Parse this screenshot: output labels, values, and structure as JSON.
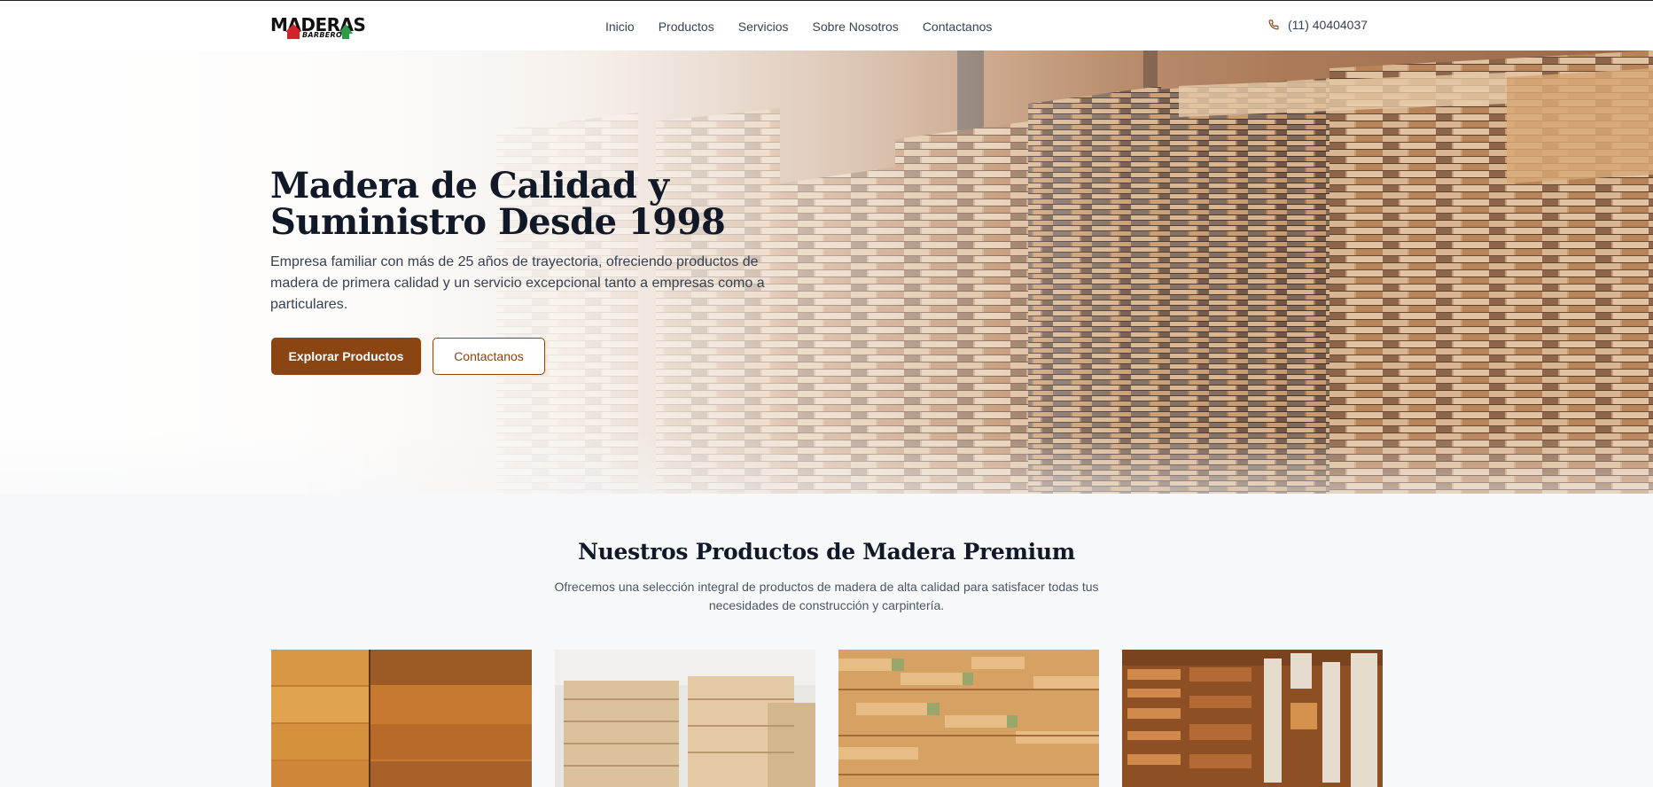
{
  "header": {
    "logo_text": "MADERAS",
    "logo_sub": "BARBERO",
    "nav": [
      "Inicio",
      "Productos",
      "Servicios",
      "Sobre Nosotros",
      "Contactanos"
    ],
    "phone": "(11) 40404037",
    "phone_icon": "phone-icon"
  },
  "hero": {
    "title_line1": "Madera de Calidad y",
    "title_line2": "Suministro Desde 1998",
    "description": "Empresa familiar con más de 25 años de trayectoria, ofreciendo productos de madera de primera calidad y un servicio excepcional tanto a empresas como a particulares.",
    "primary_button": "Explorar Productos",
    "secondary_button": "Contactanos"
  },
  "products": {
    "title": "Nuestros Productos de Madera Premium",
    "description": "Ofrecemos una selección integral de productos de madera de alta calidad para satisfacer todas tus necesidades de construcción y carpintería."
  },
  "colors": {
    "accent": "#8a4513",
    "heading": "#111827",
    "text": "#374151",
    "background": "#f7f8f9"
  }
}
